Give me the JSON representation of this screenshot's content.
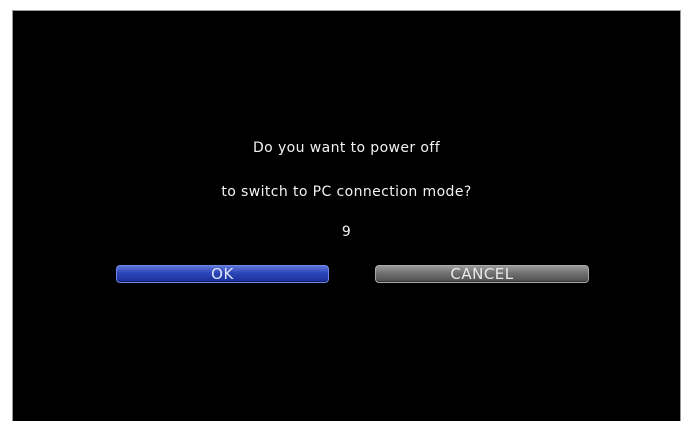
{
  "dialog": {
    "message_line1": "Do you want to power off",
    "message_line2": "to switch to PC connection mode?",
    "countdown": "9"
  },
  "buttons": {
    "ok_label": "OK",
    "cancel_label": "CANCEL"
  },
  "colors": {
    "screen_background": "#000000",
    "ok_button": "#2b45b8",
    "cancel_button": "#707070",
    "text": "#f2f2f2"
  }
}
